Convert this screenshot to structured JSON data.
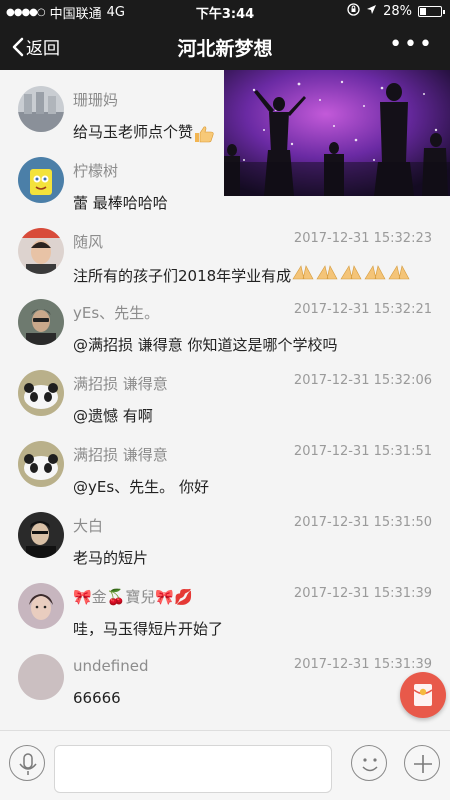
{
  "status": {
    "carrier": "中国联通",
    "network": "4G",
    "time": "下午3:44",
    "battery": "28%",
    "battery_level": 0.28
  },
  "nav": {
    "back_label": "返回",
    "title": "河北新梦想"
  },
  "messages": [
    {
      "name": "珊珊妈",
      "time": "",
      "text": "给马玉老师点个赞",
      "emoji": "thumbs-up"
    },
    {
      "name": "柠檬树",
      "time": "",
      "text": "蕾 最棒哈哈哈",
      "emoji": ""
    },
    {
      "name": "随风",
      "time": "2017-12-31 15:32:23",
      "text": "注所有的孩子们2018年学业有成",
      "emoji": "pray-x5"
    },
    {
      "name": "yEs、先生。",
      "time": "2017-12-31 15:32:21",
      "text": "@满招损 谦得意 你知道这是哪个学校吗",
      "emoji": ""
    },
    {
      "name": "满招损 谦得意",
      "time": "2017-12-31 15:32:06",
      "text": "@遗憾 有啊",
      "emoji": ""
    },
    {
      "name": "满招损 谦得意",
      "time": "2017-12-31 15:31:51",
      "text": "@yEs、先生。 你好",
      "emoji": ""
    },
    {
      "name": "大白",
      "time": "2017-12-31 15:31:50",
      "text": "老马的短片",
      "emoji": ""
    },
    {
      "name": "🎀金🍒寶兒🎀💋",
      "time": "2017-12-31 15:31:39",
      "text": "哇，马玉得短片开始了",
      "emoji": ""
    },
    {
      "name": "undefined",
      "time": "2017-12-31 15:31:39",
      "text": "66666",
      "emoji": ""
    }
  ],
  "icons": {
    "mic": "microphone-icon",
    "smile": "smile-icon",
    "plus": "plus-icon",
    "redpacket": "red-packet-icon"
  },
  "colors": {
    "navbar": "#1b1b1b",
    "background": "#f4f4f4",
    "name": "#8c8c8c",
    "redpacket": "#e8594a"
  }
}
